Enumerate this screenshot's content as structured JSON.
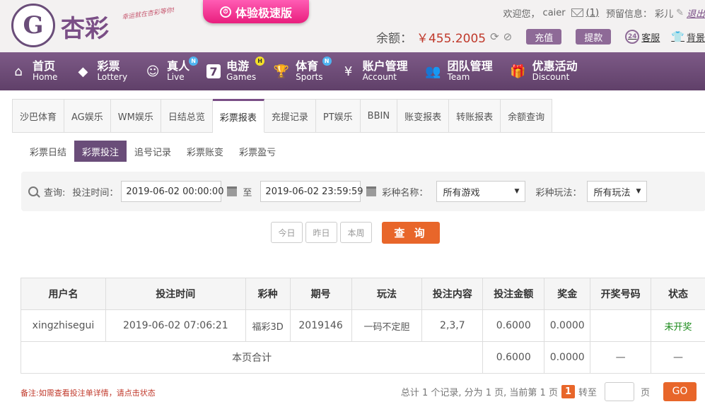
{
  "header": {
    "logo_text": "杏彩",
    "slogan": "幸运就在杏彩等你!",
    "speed_label": "体验极速版",
    "welcome": "欢迎您，",
    "username": "caier",
    "mail_count": "(1)",
    "warning_label": "预留信息：",
    "warning_value": "彩儿",
    "logout": "退出",
    "balance_label": "余额：",
    "balance_value": "￥455.2005",
    "deposit": "充值",
    "withdraw": "提款",
    "service": "客服",
    "skin": "背景"
  },
  "nav": [
    {
      "zh": "首页",
      "en": "Home",
      "icon": "home-icon",
      "badge": ""
    },
    {
      "zh": "彩票",
      "en": "Lottery",
      "icon": "ticket-icon",
      "badge": ""
    },
    {
      "zh": "真人",
      "en": "Live",
      "icon": "dealer-icon",
      "badge": "N"
    },
    {
      "zh": "电游",
      "en": "Games",
      "icon": "slot-seven-icon",
      "badge": "H"
    },
    {
      "zh": "体育",
      "en": "Sports",
      "icon": "trophy-icon",
      "badge": "N"
    },
    {
      "zh": "账户管理",
      "en": "Account",
      "icon": "yen-coin-icon",
      "badge": ""
    },
    {
      "zh": "团队管理",
      "en": "Team",
      "icon": "team-icon",
      "badge": ""
    },
    {
      "zh": "优惠活动",
      "en": "Discount",
      "icon": "gift-icon",
      "badge": ""
    }
  ],
  "tabs": [
    "沙巴体育",
    "AG娱乐",
    "WM娱乐",
    "日结总览",
    "彩票报表",
    "充提记录",
    "PT娱乐",
    "BBIN",
    "账变报表",
    "转账报表",
    "余额查询"
  ],
  "active_tab": 4,
  "subtabs": [
    "彩票日结",
    "彩票投注",
    "追号记录",
    "彩票账变",
    "彩票盈亏"
  ],
  "active_subtab": 1,
  "search": {
    "query_label": "查询:",
    "time_label": "投注时间：",
    "start": "2019-06-02 00:00:00",
    "to": "至",
    "end": "2019-06-02 23:59:59",
    "game_label": "彩种名称：",
    "game_value": "所有游戏",
    "play_label": "彩种玩法：",
    "play_value": "所有玩法"
  },
  "quick": [
    "今日",
    "昨日",
    "本周"
  ],
  "query_button": "查 询",
  "table": {
    "headers": [
      "用户名",
      "投注时间",
      "彩种",
      "期号",
      "玩法",
      "投注内容",
      "投注金额",
      "奖金",
      "开奖号码",
      "状态"
    ],
    "rows": [
      [
        "xingzhisegui",
        "2019-06-02 07:06:21",
        "福彩3D",
        "2019146",
        "一码不定胆",
        "2,3,7",
        "0.6000",
        "0.0000",
        "",
        "未开奖"
      ]
    ],
    "subtotal_label": "本页合计",
    "subtotal_amount": "0.6000",
    "subtotal_prize": "0.0000",
    "subtotal_draw": "—",
    "subtotal_status": "—"
  },
  "note": "备注:如需查看投注单详情，请点击状态",
  "pager": {
    "summary": "总计 1 个记录, 分为 1 页, 当前第 1 页",
    "current": "1",
    "goto_label": "转至",
    "page_unit": "页",
    "go": "GO"
  },
  "colors": {
    "brand": "#6a4d79",
    "accent": "#e8662a",
    "money": "#c0392b",
    "status_open": "#1a8a1a"
  }
}
